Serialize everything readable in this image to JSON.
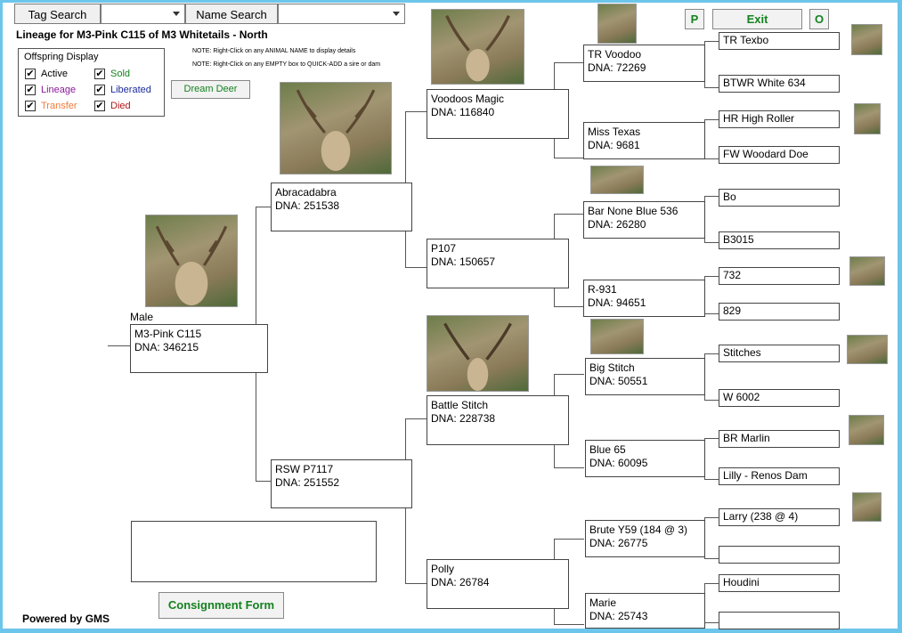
{
  "search": {
    "tag_label": "Tag Search",
    "name_label": "Name Search",
    "tag_value": "",
    "name_value": ""
  },
  "page_title": "Lineage for M3-Pink C115 of M3 Whitetails - North",
  "notes": [
    "NOTE: Right-Click on any ANIMAL NAME to display details",
    "NOTE: Right-Click on any EMPTY box to QUICK-ADD a sire or dam"
  ],
  "legend": {
    "title": "Offspring Display",
    "items": [
      {
        "label": "Active",
        "color": "#000000",
        "checked": "✔"
      },
      {
        "label": "Lineage",
        "color": "#8b1a9a",
        "checked": "✔"
      },
      {
        "label": "Transfer",
        "color": "#f07a3a",
        "checked": "✔"
      },
      {
        "label": "Sold",
        "color": "#14821e",
        "checked": "✔"
      },
      {
        "label": "Liberated",
        "color": "#1a2b9a",
        "checked": "✔"
      },
      {
        "label": "Died",
        "color": "#b01818",
        "checked": "✔"
      }
    ]
  },
  "buttons": {
    "dream_deer": "Dream Deer",
    "p": "P",
    "exit": "Exit",
    "o": "O",
    "consignment": "Consignment Form"
  },
  "footer": "Powered by GMS",
  "subject": {
    "sex": "Male",
    "name": "M3-Pink C115",
    "dna": "DNA: 346215"
  },
  "gen1": [
    {
      "name": "Abracadabra",
      "dna": "DNA: 251538"
    },
    {
      "name": "RSW P7117",
      "dna": "DNA: 251552"
    }
  ],
  "gen2": [
    {
      "name": "Voodoos Magic",
      "dna": "DNA: 116840"
    },
    {
      "name": "P107",
      "dna": "DNA: 150657"
    },
    {
      "name": "Battle Stitch",
      "dna": "DNA: 228738"
    },
    {
      "name": "Polly",
      "dna": "DNA: 26784"
    }
  ],
  "gen3": [
    {
      "name": "TR Voodoo",
      "dna": "DNA: 72269"
    },
    {
      "name": "Miss Texas",
      "dna": "DNA: 9681"
    },
    {
      "name": "Bar None Blue 536",
      "dna": "DNA: 26280"
    },
    {
      "name": "R-931",
      "dna": "DNA: 94651"
    },
    {
      "name": "Big Stitch",
      "dna": "DNA: 50551"
    },
    {
      "name": "Blue 65",
      "dna": "DNA: 60095"
    },
    {
      "name": "Brute Y59 (184 @ 3)",
      "dna": "DNA: 26775"
    },
    {
      "name": "Marie",
      "dna": "DNA: 25743"
    }
  ],
  "gen4": [
    "TR Texbo",
    "BTWR White 634",
    "HR High Roller",
    "FW Woodard Doe",
    "Bo",
    "B3015",
    "732",
    "829",
    "Stitches",
    "W 6002",
    "BR Marlin",
    "Lilly - Renos Dam",
    "Larry (238 @ 4)",
    "",
    "Houdini",
    ""
  ],
  "notes_box": ""
}
